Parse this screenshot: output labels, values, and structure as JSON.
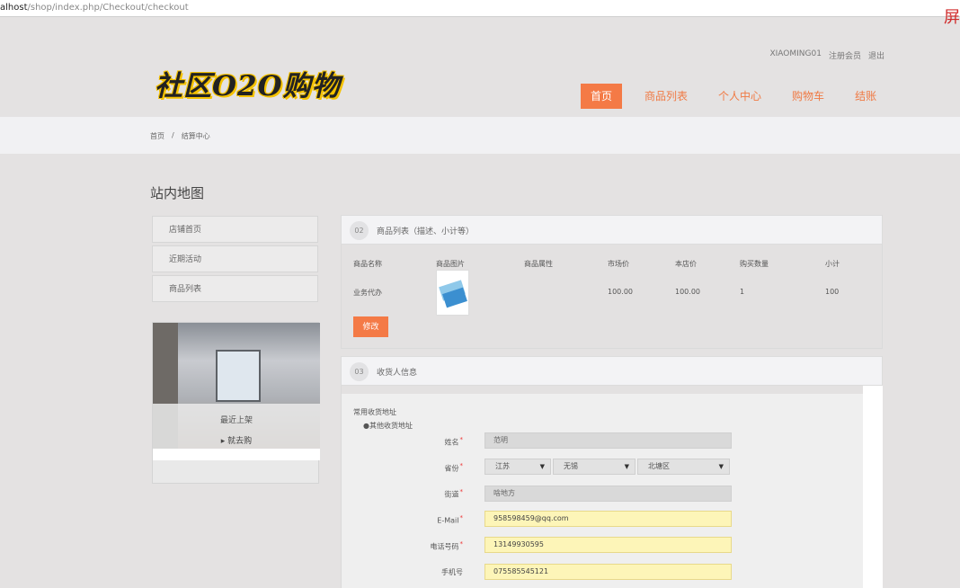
{
  "browser": {
    "url_host": "alhost",
    "url_path": "/shop/index.php/Checkout/checkout",
    "corner_glyph": "屏"
  },
  "header": {
    "logo": "社区O2O购物",
    "top_links": [
      "XIAOMING01",
      "注册会员",
      "退出"
    ],
    "nav": [
      "首页",
      "商品列表",
      "个人中心",
      "购物车",
      "结账"
    ]
  },
  "breadcrumb": {
    "home": "首页",
    "sep": "/",
    "current": "结算中心"
  },
  "sidebar": {
    "title": "站内地图",
    "items": [
      "店铺首页",
      "近期活动",
      "商品列表"
    ],
    "promo_title": "最近上架",
    "promo_link": "▸ 就去购"
  },
  "products_panel": {
    "num": "02",
    "title": "商品列表（描述、小计等）",
    "headers": [
      "商品名称",
      "商品图片",
      "商品属性",
      "市场价",
      "本店价",
      "购买数量",
      "小计"
    ],
    "rows": [
      {
        "name": "业务代办",
        "attr": "",
        "market_price": "100.00",
        "shop_price": "100.00",
        "qty": "1",
        "subtotal": "100"
      }
    ],
    "modify_label": "修改"
  },
  "receiver_panel": {
    "num": "03",
    "title": "收货人信息",
    "common_address_label": "常用收货地址",
    "other_address_label": "●其他收货地址",
    "fields": {
      "name_label": "姓名",
      "name_value": "范明",
      "province_label": "省份",
      "province": "江苏",
      "city": "无锡",
      "district": "北塘区",
      "street_label": "街道",
      "street_value": "啥地方",
      "email_label": "E-Mail",
      "email_value": "958598459@qq.com",
      "phone_label": "电话号码",
      "phone_value": "13149930595",
      "mobile_label": "手机号",
      "mobile_value": "075585545121"
    }
  },
  "colors": {
    "accent": "#f47a46",
    "autofill": "#fdf5b8"
  }
}
